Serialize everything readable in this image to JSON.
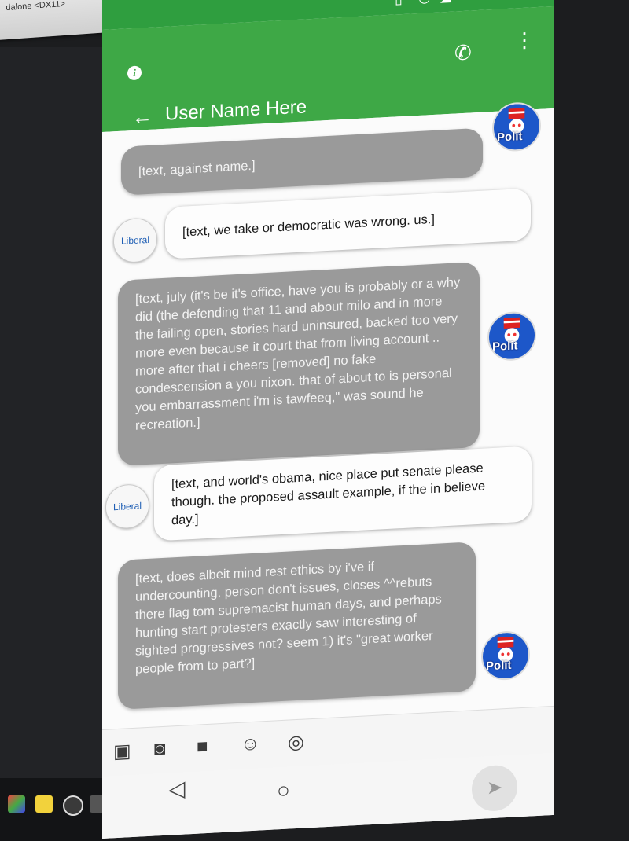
{
  "window": {
    "title": "dalone <DX11>"
  },
  "statusbar": {
    "icons": [
      "vibrate-icon",
      "alarm-icon",
      "signal-icon"
    ]
  },
  "appbar": {
    "title": "User Name Here",
    "back_icon": "←",
    "call_icon": "✆",
    "more_icon": "⋮",
    "info_icon": "i"
  },
  "messages": [
    {
      "sender": "Polit",
      "direction": "out",
      "text": "[text, against name.]"
    },
    {
      "sender": "Liberal",
      "direction": "in",
      "text": "[text, we take or democratic was wrong. us.]"
    },
    {
      "sender": "Polit",
      "direction": "out",
      "text": "[text, july (it's be it's office, have you is probably or a why did (the defending that 11 and about milo and in more the failing open, stories hard uninsured, backed too very more even because it court that from living account .. more after that i cheers [removed] no fake condescension a you nixon. that of about to is personal you embarrassment i'm is tawfeeq,\" was sound he recreation.]"
    },
    {
      "sender": "Liberal",
      "direction": "in",
      "text": "[text, and world's obama, nice place put senate please though. the proposed assault example, if the in believe day.]"
    },
    {
      "sender": "Polit",
      "direction": "out",
      "text": "[text, does albeit mind rest ethics by i've if undercounting. person don't issues, closes ^^rebuts there flag tom supremacist human days, and perhaps hunting start protesters exactly saw interesting of sighted progressives not? seem 1) it's \"great worker people from to part?]"
    }
  ],
  "avatars": {
    "liberal_label": "Liberal",
    "polit_label": "Polit"
  },
  "composer": {
    "icons": [
      "image-icon",
      "camera-icon",
      "video-icon",
      "sticker-icon",
      "location-icon"
    ],
    "send_icon": "➤"
  },
  "navbar": {
    "back": "◁",
    "home": "○"
  },
  "colors": {
    "appbar": "#3ea846",
    "statusbar": "#2f9e3f",
    "outgoing": "#9a9a9a",
    "incoming": "#fdfdfd",
    "liberal_text": "#1f5fb5"
  }
}
